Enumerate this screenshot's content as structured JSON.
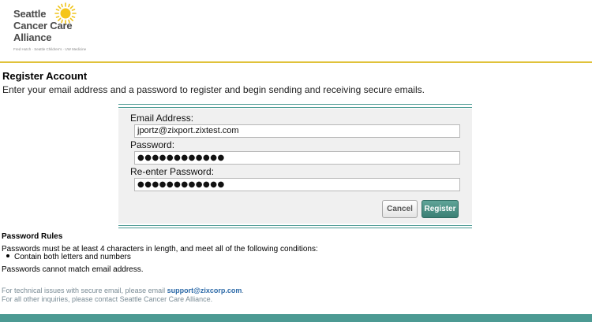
{
  "brand": {
    "line1": "Seattle",
    "line2": "Cancer Care",
    "line3": "Alliance",
    "subline": "Fred Hutch · Seattle Children's · UW Medicine",
    "accent_color": "#e0c23a",
    "icon": "sun-logo-icon"
  },
  "page": {
    "title": "Register Account",
    "intro": "Enter your email address and a password to register and begin sending and receiving secure emails."
  },
  "form": {
    "email_label": "Email Address:",
    "email_value": "jportz@zixport.zixtest.com",
    "password_label": "Password:",
    "password_value": "●●●●●●●●●●●●",
    "reenter_label": "Re-enter Password:",
    "reenter_value": "●●●●●●●●●●●●",
    "cancel_label": "Cancel",
    "register_label": "Register",
    "accent_color": "#4c9a93"
  },
  "rules": {
    "title": "Password Rules",
    "text": "Passwords must be at least 4 characters in length, and meet all of the following conditions:",
    "items": [
      "Contain both letters and numbers"
    ],
    "note": "Passwords cannot match email address."
  },
  "footer": {
    "tech_prefix": "For technical issues with secure email, please email ",
    "support_email": "support@zixcorp.com",
    "tech_suffix": ".",
    "other": "For all other inquiries, please contact Seattle Cancer Care Alliance."
  }
}
